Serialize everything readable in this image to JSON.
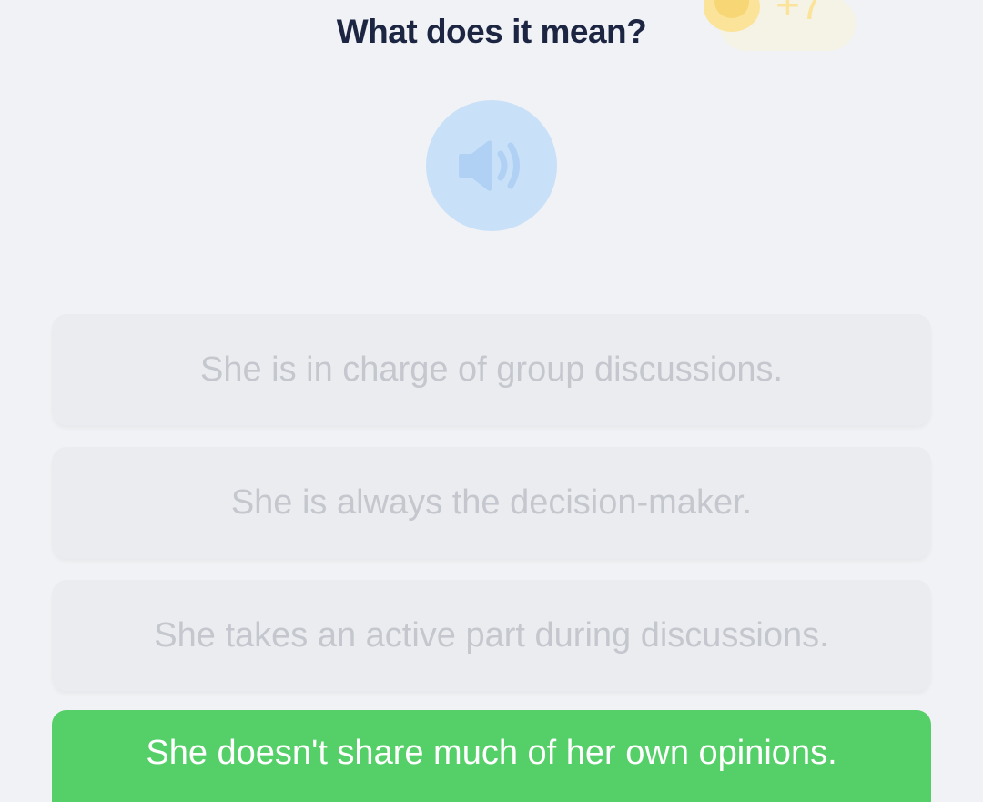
{
  "question": {
    "title": "What does it mean?"
  },
  "reward": {
    "icon": "coin-icon",
    "amount": "+7"
  },
  "audio": {
    "icon": "speaker-icon"
  },
  "options": [
    {
      "label": "She is in charge of group discussions.",
      "state": "disabled"
    },
    {
      "label": "She is always the decision-maker.",
      "state": "disabled"
    },
    {
      "label": "She takes an active part during discussions.",
      "state": "disabled"
    },
    {
      "label": "She doesn't share much of her own opinions.",
      "state": "correct"
    }
  ],
  "colors": {
    "background": "#f0f2f5",
    "title": "#1c2541",
    "option_disabled_bg": "#ebecef",
    "option_disabled_text": "#c4c7ce",
    "correct": "#55cf68",
    "audio_bg": "#c8e0f8",
    "coin": "#fbe49a"
  }
}
